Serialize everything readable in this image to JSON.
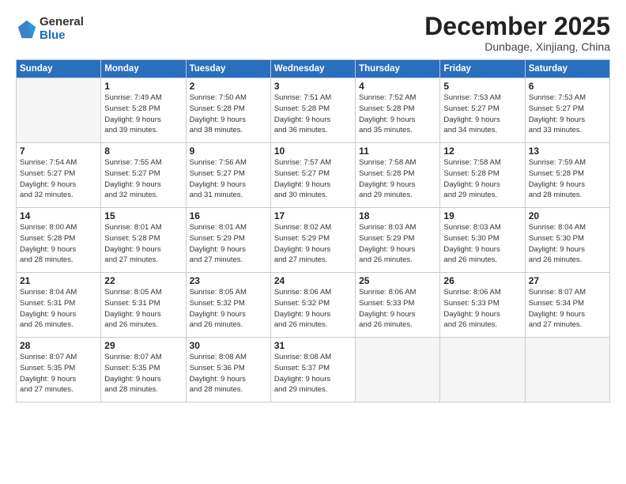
{
  "logo": {
    "general": "General",
    "blue": "Blue"
  },
  "header": {
    "month": "December 2025",
    "location": "Dunbage, Xinjiang, China"
  },
  "weekdays": [
    "Sunday",
    "Monday",
    "Tuesday",
    "Wednesday",
    "Thursday",
    "Friday",
    "Saturday"
  ],
  "weeks": [
    [
      {
        "day": "",
        "info": ""
      },
      {
        "day": "1",
        "info": "Sunrise: 7:49 AM\nSunset: 5:28 PM\nDaylight: 9 hours\nand 39 minutes."
      },
      {
        "day": "2",
        "info": "Sunrise: 7:50 AM\nSunset: 5:28 PM\nDaylight: 9 hours\nand 38 minutes."
      },
      {
        "day": "3",
        "info": "Sunrise: 7:51 AM\nSunset: 5:28 PM\nDaylight: 9 hours\nand 36 minutes."
      },
      {
        "day": "4",
        "info": "Sunrise: 7:52 AM\nSunset: 5:28 PM\nDaylight: 9 hours\nand 35 minutes."
      },
      {
        "day": "5",
        "info": "Sunrise: 7:53 AM\nSunset: 5:27 PM\nDaylight: 9 hours\nand 34 minutes."
      },
      {
        "day": "6",
        "info": "Sunrise: 7:53 AM\nSunset: 5:27 PM\nDaylight: 9 hours\nand 33 minutes."
      }
    ],
    [
      {
        "day": "7",
        "info": "Sunrise: 7:54 AM\nSunset: 5:27 PM\nDaylight: 9 hours\nand 32 minutes."
      },
      {
        "day": "8",
        "info": "Sunrise: 7:55 AM\nSunset: 5:27 PM\nDaylight: 9 hours\nand 32 minutes."
      },
      {
        "day": "9",
        "info": "Sunrise: 7:56 AM\nSunset: 5:27 PM\nDaylight: 9 hours\nand 31 minutes."
      },
      {
        "day": "10",
        "info": "Sunrise: 7:57 AM\nSunset: 5:27 PM\nDaylight: 9 hours\nand 30 minutes."
      },
      {
        "day": "11",
        "info": "Sunrise: 7:58 AM\nSunset: 5:28 PM\nDaylight: 9 hours\nand 29 minutes."
      },
      {
        "day": "12",
        "info": "Sunrise: 7:58 AM\nSunset: 5:28 PM\nDaylight: 9 hours\nand 29 minutes."
      },
      {
        "day": "13",
        "info": "Sunrise: 7:59 AM\nSunset: 5:28 PM\nDaylight: 9 hours\nand 28 minutes."
      }
    ],
    [
      {
        "day": "14",
        "info": "Sunrise: 8:00 AM\nSunset: 5:28 PM\nDaylight: 9 hours\nand 28 minutes."
      },
      {
        "day": "15",
        "info": "Sunrise: 8:01 AM\nSunset: 5:28 PM\nDaylight: 9 hours\nand 27 minutes."
      },
      {
        "day": "16",
        "info": "Sunrise: 8:01 AM\nSunset: 5:29 PM\nDaylight: 9 hours\nand 27 minutes."
      },
      {
        "day": "17",
        "info": "Sunrise: 8:02 AM\nSunset: 5:29 PM\nDaylight: 9 hours\nand 27 minutes."
      },
      {
        "day": "18",
        "info": "Sunrise: 8:03 AM\nSunset: 5:29 PM\nDaylight: 9 hours\nand 26 minutes."
      },
      {
        "day": "19",
        "info": "Sunrise: 8:03 AM\nSunset: 5:30 PM\nDaylight: 9 hours\nand 26 minutes."
      },
      {
        "day": "20",
        "info": "Sunrise: 8:04 AM\nSunset: 5:30 PM\nDaylight: 9 hours\nand 26 minutes."
      }
    ],
    [
      {
        "day": "21",
        "info": "Sunrise: 8:04 AM\nSunset: 5:31 PM\nDaylight: 9 hours\nand 26 minutes."
      },
      {
        "day": "22",
        "info": "Sunrise: 8:05 AM\nSunset: 5:31 PM\nDaylight: 9 hours\nand 26 minutes."
      },
      {
        "day": "23",
        "info": "Sunrise: 8:05 AM\nSunset: 5:32 PM\nDaylight: 9 hours\nand 26 minutes."
      },
      {
        "day": "24",
        "info": "Sunrise: 8:06 AM\nSunset: 5:32 PM\nDaylight: 9 hours\nand 26 minutes."
      },
      {
        "day": "25",
        "info": "Sunrise: 8:06 AM\nSunset: 5:33 PM\nDaylight: 9 hours\nand 26 minutes."
      },
      {
        "day": "26",
        "info": "Sunrise: 8:06 AM\nSunset: 5:33 PM\nDaylight: 9 hours\nand 26 minutes."
      },
      {
        "day": "27",
        "info": "Sunrise: 8:07 AM\nSunset: 5:34 PM\nDaylight: 9 hours\nand 27 minutes."
      }
    ],
    [
      {
        "day": "28",
        "info": "Sunrise: 8:07 AM\nSunset: 5:35 PM\nDaylight: 9 hours\nand 27 minutes."
      },
      {
        "day": "29",
        "info": "Sunrise: 8:07 AM\nSunset: 5:35 PM\nDaylight: 9 hours\nand 28 minutes."
      },
      {
        "day": "30",
        "info": "Sunrise: 8:08 AM\nSunset: 5:36 PM\nDaylight: 9 hours\nand 28 minutes."
      },
      {
        "day": "31",
        "info": "Sunrise: 8:08 AM\nSunset: 5:37 PM\nDaylight: 9 hours\nand 29 minutes."
      },
      {
        "day": "",
        "info": ""
      },
      {
        "day": "",
        "info": ""
      },
      {
        "day": "",
        "info": ""
      }
    ]
  ]
}
